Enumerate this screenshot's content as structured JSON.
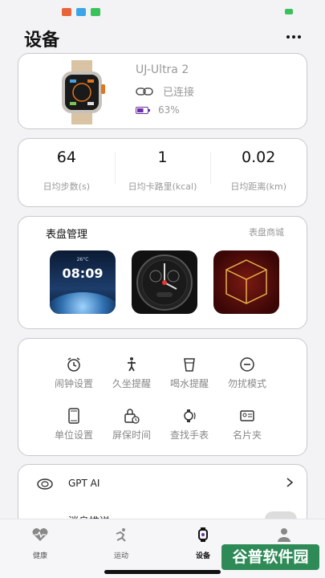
{
  "header": {
    "title": "设备"
  },
  "device": {
    "name": "UJ-Ultra 2",
    "status": "已连接",
    "battery": "63%",
    "battery_level": 0.63
  },
  "stats": [
    {
      "value": "64",
      "label": "日均步数(s)"
    },
    {
      "value": "1",
      "label": "日均卡路里(kcal)"
    },
    {
      "value": "0.02",
      "label": "日均距离(km)"
    }
  ],
  "watch_faces": {
    "title": "表盘管理",
    "store_link": "表盘商城",
    "face1_time": "08:09",
    "face1_small": "26°C"
  },
  "tools": [
    {
      "label": "闹钟设置",
      "icon": "alarm-clock-icon"
    },
    {
      "label": "久坐提醒",
      "icon": "sedentary-person-icon"
    },
    {
      "label": "喝水提醒",
      "icon": "water-cup-icon"
    },
    {
      "label": "勿扰模式",
      "icon": "do-not-disturb-icon"
    },
    {
      "label": "单位设置",
      "icon": "phone-unit-icon"
    },
    {
      "label": "屏保时间",
      "icon": "screen-lock-timer-icon"
    },
    {
      "label": "查找手表",
      "icon": "find-watch-icon"
    },
    {
      "label": "名片夹",
      "icon": "business-card-icon"
    }
  ],
  "list": {
    "gpt_label": "GPT AI",
    "row2_label": "消息推送"
  },
  "tabbar": [
    {
      "label": "健康",
      "icon": "health-heart-icon"
    },
    {
      "label": "运动",
      "icon": "running-icon"
    },
    {
      "label": "设备",
      "icon": "watch-device-icon",
      "active": true
    },
    {
      "label": "",
      "icon": "profile-icon"
    }
  ],
  "watermark": "谷普软件园",
  "colors": {
    "accent": "#6b2fa6",
    "card_border": "#c9c9cf",
    "background": "#f3f3f5"
  }
}
